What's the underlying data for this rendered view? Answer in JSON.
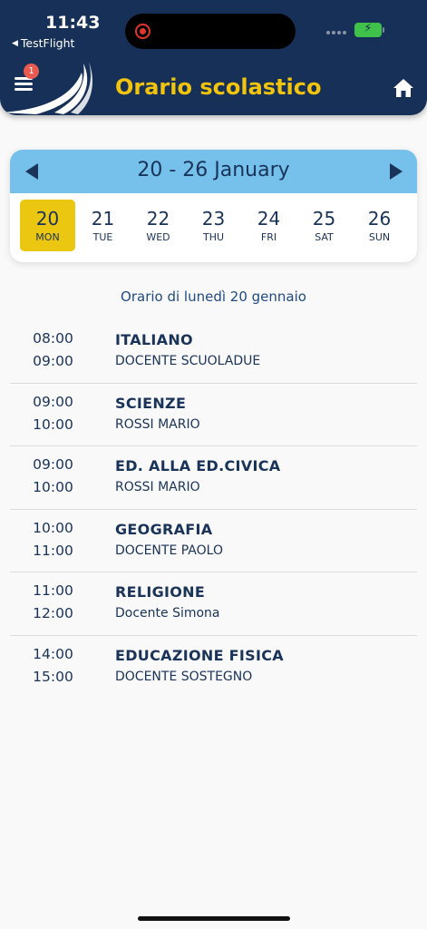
{
  "status": {
    "time": "11:43",
    "back_app": "TestFlight",
    "battery_color": "#3fc14a"
  },
  "header": {
    "title": "Orario scolastico",
    "notification_count": "1",
    "menu_icon": "hamburger-menu-icon",
    "home_icon": "home-icon",
    "background": "#173058",
    "title_color": "#f2c40c"
  },
  "week": {
    "label": "20 - 26 January",
    "prev_icon": "triangle-left-icon",
    "next_icon": "triangle-right-icon",
    "days": [
      {
        "num": "20",
        "dow": "MON",
        "selected": true
      },
      {
        "num": "21",
        "dow": "TUE"
      },
      {
        "num": "22",
        "dow": "WED"
      },
      {
        "num": "23",
        "dow": "THU"
      },
      {
        "num": "24",
        "dow": "FRI"
      },
      {
        "num": "25",
        "dow": "SAT"
      },
      {
        "num": "26",
        "dow": "SUN"
      }
    ],
    "selected_color": "#ecc711",
    "header_color": "#76c0ec"
  },
  "schedule": {
    "title": "Orario di lunedì 20 gennaio",
    "lessons": [
      {
        "start": "08:00",
        "end": "09:00",
        "subject": "ITALIANO",
        "teacher": "DOCENTE SCUOLADUE"
      },
      {
        "start": "09:00",
        "end": "10:00",
        "subject": "SCIENZE",
        "teacher": "ROSSI MARIO"
      },
      {
        "start": "09:00",
        "end": "10:00",
        "subject": "ED. ALLA ED.CIVICA",
        "teacher": "ROSSI MARIO"
      },
      {
        "start": "10:00",
        "end": "11:00",
        "subject": "GEOGRAFIA",
        "teacher": "DOCENTE PAOLO"
      },
      {
        "start": "11:00",
        "end": "12:00",
        "subject": "RELIGIONE",
        "teacher": "Docente Simona"
      },
      {
        "start": "14:00",
        "end": "15:00",
        "subject": "EDUCAZIONE FISICA",
        "teacher": "DOCENTE SOSTEGNO"
      }
    ]
  }
}
